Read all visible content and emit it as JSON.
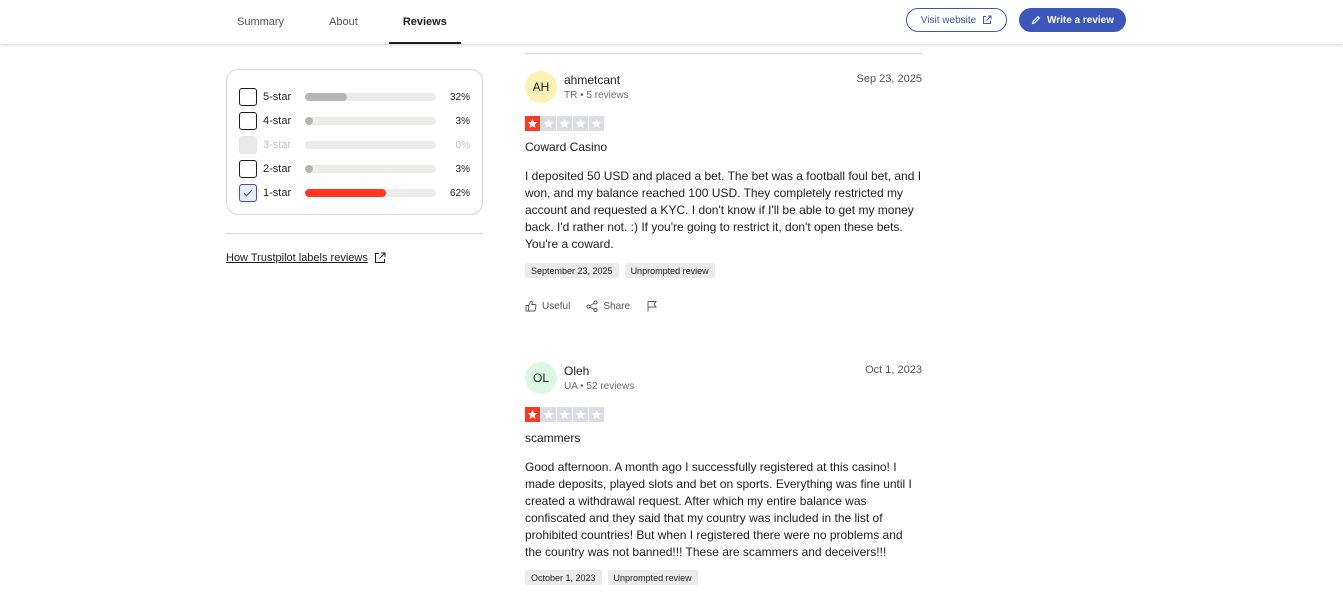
{
  "tabs": [
    {
      "label": "Summary",
      "active": false
    },
    {
      "label": "About",
      "active": false
    },
    {
      "label": "Reviews",
      "active": true
    }
  ],
  "header": {
    "visit_label": "Visit website",
    "write_label": "Write a review",
    "accent_color": "#3c57bc"
  },
  "filter": {
    "rows": [
      {
        "label": "5-star",
        "percent_text": "32%",
        "percent": 32,
        "color": "#b5b5b1",
        "state": "unchecked"
      },
      {
        "label": "4-star",
        "percent_text": "3%",
        "percent": 3,
        "color": "#b5b5b1",
        "state": "unchecked"
      },
      {
        "label": "3-star",
        "percent_text": "0%",
        "percent": 0,
        "color": "#e0e0dc",
        "state": "disabled"
      },
      {
        "label": "2-star",
        "percent_text": "3%",
        "percent": 3,
        "color": "#b5b5b1",
        "state": "unchecked"
      },
      {
        "label": "1-star",
        "percent_text": "62%",
        "percent": 62,
        "color": "#ff3722",
        "state": "checked"
      }
    ]
  },
  "labels_link": "How Trustpilot labels reviews",
  "reviews": [
    {
      "initials": "AH",
      "avatar_color": "#fdf1b6",
      "name": "ahmetcant",
      "meta": "TR • 5 reviews",
      "date": "Sep 23, 2025",
      "rating": 1,
      "title": "Coward Casino",
      "body": "I deposited 50 USD and placed a bet. The bet was a football foul bet, and I won, and my balance reached 100 USD. They completely restricted my account and requested a KYC. I don't know if I'll be able to get my money back. I'd rather not. :) If you're going to restrict it, don't open these bets. You're a coward.",
      "experience_date": "September 23, 2025",
      "tag": "Unprompted review",
      "useful_label": "Useful",
      "share_label": "Share"
    },
    {
      "initials": "OL",
      "avatar_color": "#dcf8e4",
      "name": "Oleh",
      "meta": "UA • 52 reviews",
      "date": "Oct 1, 2023",
      "rating": 1,
      "title": "scammers",
      "body": "Good afternoon. A month ago I successfully registered at this casino! I made deposits, played slots and bet on sports. Everything was fine until I created a withdrawal request. After which my entire balance was confiscated and they said that my country was included in the list of prohibited countries! But when I registered there were no problems and the country was not banned!!! These are scammers and deceivers!!!",
      "experience_date": "October 1, 2023",
      "tag": "Unprompted review"
    }
  ]
}
